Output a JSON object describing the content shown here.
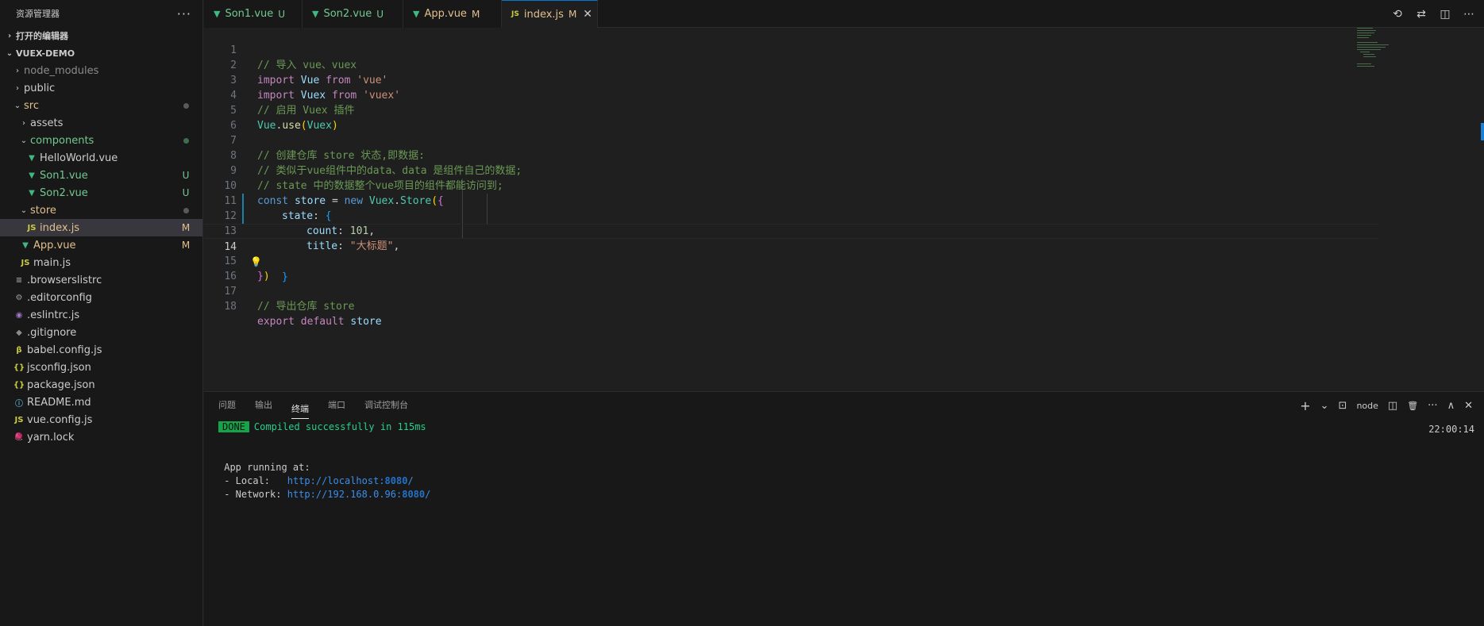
{
  "sidebar": {
    "title": "资源管理器",
    "more": "···",
    "open_editors": "打开的编辑器",
    "project": "VUEX-DEMO",
    "tree": [
      {
        "label": "node_modules",
        "chevron": "›",
        "icon": "",
        "badge": ""
      },
      {
        "label": "public",
        "chevron": "›",
        "icon": "",
        "badge": ""
      },
      {
        "label": "src",
        "chevron": "⌄",
        "icon": "",
        "badge": ""
      },
      {
        "label": "assets",
        "chevron": "›",
        "icon": "",
        "badge": ""
      },
      {
        "label": "components",
        "chevron": "⌄",
        "icon": "",
        "badge": ""
      },
      {
        "label": "HelloWorld.vue",
        "chevron": "",
        "icon": "▼",
        "badge": ""
      },
      {
        "label": "Son1.vue",
        "chevron": "",
        "icon": "▼",
        "badge": "U"
      },
      {
        "label": "Son2.vue",
        "chevron": "",
        "icon": "▼",
        "badge": "U"
      },
      {
        "label": "store",
        "chevron": "⌄",
        "icon": "",
        "badge": ""
      },
      {
        "label": "index.js",
        "chevron": "",
        "icon": "JS",
        "badge": "M"
      },
      {
        "label": "App.vue",
        "chevron": "",
        "icon": "▼",
        "badge": "M"
      },
      {
        "label": "main.js",
        "chevron": "",
        "icon": "JS",
        "badge": ""
      },
      {
        "label": ".browserslistrc",
        "chevron": "",
        "icon": "≡",
        "badge": ""
      },
      {
        "label": ".editorconfig",
        "chevron": "",
        "icon": "⚙",
        "badge": ""
      },
      {
        "label": ".eslintrc.js",
        "chevron": "",
        "icon": "◉",
        "badge": ""
      },
      {
        "label": ".gitignore",
        "chevron": "",
        "icon": "◆",
        "badge": ""
      },
      {
        "label": "babel.config.js",
        "chevron": "",
        "icon": "β",
        "badge": ""
      },
      {
        "label": "jsconfig.json",
        "chevron": "",
        "icon": "{}",
        "badge": ""
      },
      {
        "label": "package.json",
        "chevron": "",
        "icon": "{}",
        "badge": ""
      },
      {
        "label": "README.md",
        "chevron": "",
        "icon": "ⓘ",
        "badge": ""
      },
      {
        "label": "vue.config.js",
        "chevron": "",
        "icon": "JS",
        "badge": ""
      },
      {
        "label": "yarn.lock",
        "chevron": "",
        "icon": "🧶",
        "badge": ""
      }
    ]
  },
  "tabs": [
    {
      "label": "Son1.vue",
      "icon": "▼",
      "status": "U"
    },
    {
      "label": "Son2.vue",
      "icon": "▼",
      "status": "U"
    },
    {
      "label": "App.vue",
      "icon": "▼",
      "status": "M"
    },
    {
      "label": "index.js",
      "icon": "JS",
      "status": "M",
      "close": "✕"
    }
  ],
  "editor": {
    "line_numbers": [
      "1",
      "2",
      "3",
      "4",
      "5",
      "6",
      "7",
      "8",
      "9",
      "10",
      "11",
      "12",
      "13",
      "14",
      "15",
      "16",
      "17",
      "18"
    ],
    "code": {
      "l1": "// 导入 vue、vuex",
      "l2_kw": "import",
      "l2_id": "Vue",
      "l2_from": "from",
      "l2_str": "'vue'",
      "l3_kw": "import",
      "l3_id": "Vuex",
      "l3_from": "from",
      "l3_str": "'vuex'",
      "l4": "// 启用 Vuex 插件",
      "l5_obj": "Vue",
      "l5_dot": ".",
      "l5_fn": "use",
      "l5_open": "(",
      "l5_arg": "Vuex",
      "l5_close": ")",
      "l7": "// 创建仓库 store 状态,即数据:",
      "l8": "// 类似于vue组件中的data、data 是组件自己的数据;",
      "l9": "// state 中的数据整个vue项目的组件都能访问到;",
      "l10_const": "const",
      "l10_var": "store",
      "l10_eq": "=",
      "l10_new": "new",
      "l10_cls": "Vuex",
      "l10_dot": ".",
      "l10_store": "Store",
      "l10_p": "(",
      "l10_b": "{",
      "l11_key": "state",
      "l11_colon": ":",
      "l11_b": "{",
      "l12_key": "count",
      "l12_colon": ":",
      "l12_val": "101",
      "l12_comma": ",",
      "l13_key": "title",
      "l13_colon": ":",
      "l13_val": "\"大标题\"",
      "l13_comma": ",",
      "l14_b": "}",
      "l15_b": "}",
      "l15_p": ")",
      "l17": "// 导出仓库 store",
      "l18_export": "export",
      "l18_default": "default",
      "l18_var": "store"
    },
    "bulb": "💡"
  },
  "panel": {
    "tabs": [
      "问题",
      "输出",
      "终端",
      "端口",
      "调试控制台"
    ],
    "active_tab": "终端",
    "actions": {
      "add": "+",
      "chevron": "⌄",
      "terminal_icon": "⊡",
      "node": "node",
      "split": "◫",
      "trash": "🗑",
      "more": "···",
      "maximize": "∧",
      "close": "✕"
    },
    "terminal": {
      "done": "DONE",
      "compiled": "Compiled successfully in 115ms",
      "time": "22:00:14",
      "running": "App running at:",
      "local_label": "- Local:   ",
      "local_url": "http://localhost:",
      "local_port": "8080",
      "local_slash": "/",
      "network_label": "- Network: ",
      "network_url": "http://192.168.0.96:",
      "network_port": "8080",
      "network_slash": "/"
    }
  },
  "title_icons": [
    "⟲",
    "⇄",
    "◫",
    "⋯"
  ]
}
